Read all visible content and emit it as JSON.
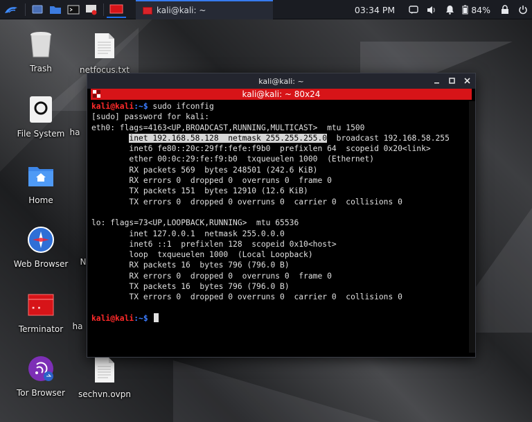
{
  "panel": {
    "clock": "03:34 PM",
    "battery": "84%",
    "task_title": "kali@kali: ~"
  },
  "desktop": {
    "icons": [
      {
        "label": "Trash",
        "icon": "trash-icon"
      },
      {
        "label": "netfocus.txt",
        "icon": "text-file-icon"
      },
      {
        "label": "File System",
        "icon": "drive-icon"
      },
      {
        "label": "Home",
        "icon": "home-folder-icon"
      },
      {
        "label": "Web Browser",
        "icon": "browser-icon"
      },
      {
        "label": "Terminator",
        "icon": "terminator-icon"
      },
      {
        "label": "Tor Browser",
        "icon": "tor-browser-icon"
      },
      {
        "label": "sechvn.ovpn",
        "icon": "text-file-icon"
      },
      {
        "label": "ha",
        "icon": "partial-label"
      },
      {
        "label": "ha",
        "icon": "partial-label"
      },
      {
        "label": "N",
        "icon": "partial-label"
      },
      {
        "label": "ha",
        "icon": "partial-label"
      }
    ]
  },
  "window": {
    "title": "kali@kali: ~",
    "terminal_title": "kali@kali: ~ 80x24"
  },
  "terminal": {
    "prompt_user": "kali@kali",
    "prompt_path": ":~$",
    "command": " sudo ifconfig",
    "lines": [
      "[sudo] password for kali:",
      "eth0: flags=4163<UP,BROADCAST,RUNNING,MULTICAST>  mtu 1500",
      "        ",
      "inet 192.168.58.128  netmask 255.255.255.0",
      "  broadcast 192.168.58.255",
      "        inet6 fe80::20c:29ff:fefe:f9b0  prefixlen 64  scopeid 0x20<link>",
      "        ether 00:0c:29:fe:f9:b0  txqueuelen 1000  (Ethernet)",
      "        RX packets 569  bytes 248501 (242.6 KiB)",
      "        RX errors 0  dropped 0  overruns 0  frame 0",
      "        TX packets 151  bytes 12910 (12.6 KiB)",
      "        TX errors 0  dropped 0 overruns 0  carrier 0  collisions 0",
      "",
      "lo: flags=73<UP,LOOPBACK,RUNNING>  mtu 65536",
      "        inet 127.0.0.1  netmask 255.0.0.0",
      "        inet6 ::1  prefixlen 128  scopeid 0x10<host>",
      "        loop  txqueuelen 1000  (Local Loopback)",
      "        RX packets 16  bytes 796 (796.0 B)",
      "        RX errors 0  dropped 0  overruns 0  frame 0",
      "        TX packets 16  bytes 796 (796.0 B)",
      "        TX errors 0  dropped 0 overruns 0  carrier 0  collisions 0",
      ""
    ]
  },
  "colors": {
    "accent_red": "#d71418",
    "prompt_user": "#ff2a2a",
    "prompt_path": "#3b7cff",
    "panel_bg": "#1a1c22"
  }
}
